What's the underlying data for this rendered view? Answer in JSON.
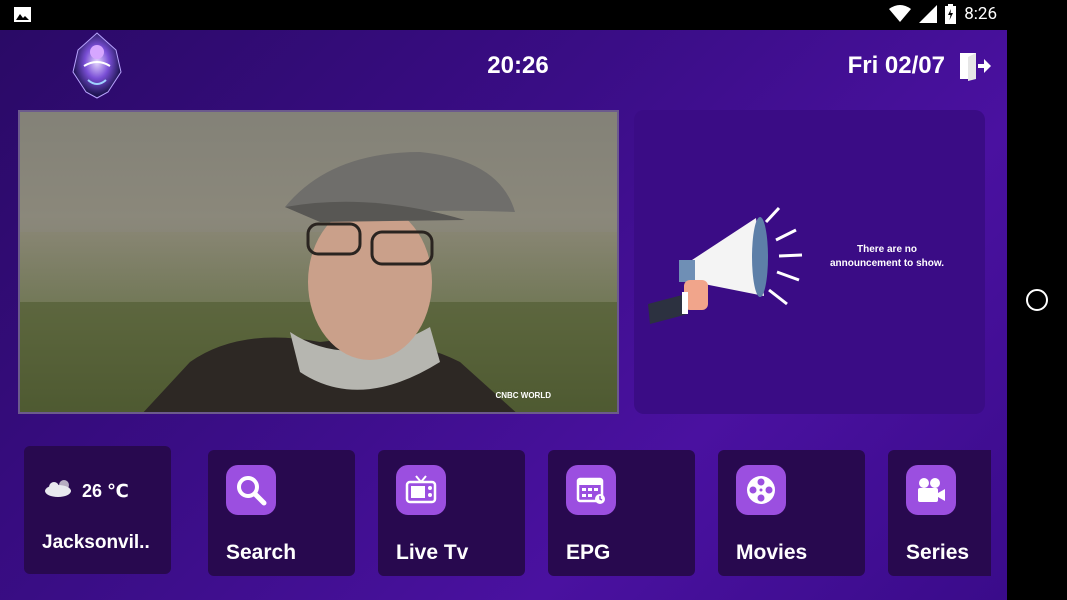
{
  "status_bar": {
    "time": "8:26"
  },
  "header": {
    "clock": "20:26",
    "date": "Fri 02/07"
  },
  "announcement": {
    "text": "There are no announcement to show."
  },
  "video": {
    "channel_badge": "CNBC WORLD"
  },
  "weather": {
    "temperature": "26 ℃",
    "city": "Jacksonvil.."
  },
  "menu": {
    "items": [
      {
        "label": "Search",
        "icon": "search-icon"
      },
      {
        "label": "Live Tv",
        "icon": "tv-icon"
      },
      {
        "label": "EPG",
        "icon": "calendar-icon"
      },
      {
        "label": "Movies",
        "icon": "film-reel-icon"
      },
      {
        "label": "Series",
        "icon": "video-camera-icon"
      }
    ]
  },
  "colors": {
    "accent": "#9b4fe0",
    "tile_bg": "#28094f",
    "panel_bg": "#3a0c85"
  }
}
